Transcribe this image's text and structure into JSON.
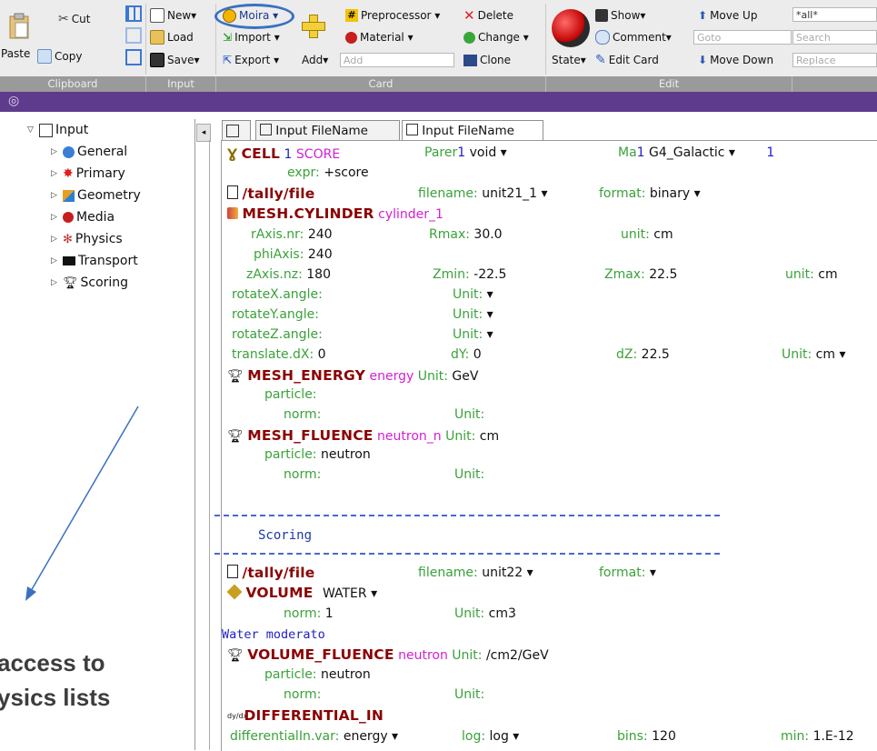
{
  "ribbon": {
    "clipboard": {
      "cut": "Cut",
      "paste": "Paste",
      "copy": "Copy"
    },
    "input": {
      "new": "New▾",
      "load": "Load",
      "save": "Save▾"
    },
    "card": {
      "moira": "Moira ▾",
      "import": "Import ▾",
      "export": "Export ▾",
      "add": "Add▾",
      "add_placeholder": "Add",
      "preprocessor": "Preprocessor ▾",
      "material": "Material ▾",
      "delete": "Delete",
      "change": "Change ▾",
      "clone": "Clone"
    },
    "edit": {
      "state": "State▾",
      "show": "Show▾",
      "comment": "Comment▾",
      "goto_placeholder": "Goto",
      "edit_card": "Edit Card",
      "move_up": "Move Up",
      "move_down": "Move Down",
      "filter_value": "*all*",
      "search_placeholder": "Search",
      "replace_placeholder": "Replace"
    },
    "groups": {
      "clipboard": "Clipboard",
      "input": "Input",
      "card": "Card",
      "edit": "Edit"
    }
  },
  "tree": {
    "root": "Input",
    "items": [
      "General",
      "Primary",
      "Geometry",
      "Media",
      "Physics",
      "Transport",
      "Scoring"
    ]
  },
  "tabs": [
    "Input FileName",
    "Input FileName"
  ],
  "editor": {
    "cell": {
      "name": "CELL",
      "marker": "1",
      "score": "SCORE",
      "parent_label": "Parer",
      "parent_value": "void ▾",
      "mat_label": "Ma",
      "mat_value": "G4_Galactic ▾",
      "expr_label": "expr:",
      "expr_value": "+score"
    },
    "tally1": {
      "name": "/tally/file",
      "filename_label": "filename:",
      "filename_value": "unit21_1 ▾",
      "format_label": "format:",
      "format_value": "binary ▾"
    },
    "mesh_cyl": {
      "name": "MESH.CYLINDER",
      "id": "cylinder_1",
      "r_label": "rAxis.nr:",
      "r_value": "240",
      "rmax_label": "Rmax:",
      "rmax_value": "30.0",
      "unit_label": "unit:",
      "unit_value": "cm",
      "phi_label": "phiAxis:",
      "phi_value": "240",
      "z_label": "zAxis.nz:",
      "z_value": "180",
      "zmin_label": "Zmin:",
      "zmin_value": "-22.5",
      "zmax_label": "Zmax:",
      "zmax_value": "22.5",
      "unit2_label": "unit:",
      "unit2_value": "cm",
      "rx_label": "rotateX.angle:",
      "ry_label": "rotateY.angle:",
      "rz_label": "rotateZ.angle:",
      "runit_label": "Unit:",
      "runit_value": "▾",
      "t_label": "translate.dX:",
      "t_value": "0",
      "dy_label": "dY:",
      "dy_value": "0",
      "dz_label": "dZ:",
      "dz_value": "22.5",
      "tunit_label": "Unit:",
      "tunit_value": "cm ▾"
    },
    "mesh_energy": {
      "name": "MESH_ENERGY",
      "id": "energy",
      "unit_label": "Unit:",
      "unit_value": "GeV",
      "particle_label": "particle:",
      "norm_label": "norm:",
      "nunit_label": "Unit:"
    },
    "mesh_fluence": {
      "name": "MESH_FLUENCE",
      "id": "neutron_n",
      "unit_label": "Unit:",
      "unit_value": "cm",
      "particle_label": "particle:",
      "particle_value": "neutron",
      "norm_label": "norm:",
      "nunit_label": "Unit:"
    },
    "section": "Scoring",
    "tally2": {
      "name": "/tally/file",
      "filename_label": "filename:",
      "filename_value": "unit22 ▾",
      "format_label": "format:",
      "format_value": "▾"
    },
    "volume": {
      "name": "VOLUME",
      "material": "WATER ▾",
      "norm_label": "norm:",
      "norm_value": "1",
      "unit_label": "Unit:",
      "unit_value": "cm3",
      "comment": "Water moderato"
    },
    "volume_fluence": {
      "name": "VOLUME_FLUENCE",
      "id": "neutron",
      "unit_label": "Unit:",
      "unit_value": "/cm2/GeV",
      "particle_label": "particle:",
      "particle_value": "neutron",
      "norm_label": "norm:",
      "nunit_label": "Unit:"
    },
    "differential": {
      "name": "DIFFERENTIAL_IN",
      "icon_text": "dy/dx",
      "var_label": "differentialIn.var:",
      "var_value": "energy ▾",
      "log_label": "log:",
      "log_value": "log ▾",
      "bins_label": "bins:",
      "bins_value": "120",
      "min_label": "min:",
      "min_value": "1.E-12"
    }
  },
  "annotation": {
    "line1": "access to",
    "line2": "ysics lists"
  },
  "colors": {
    "keyword": "#8b0000",
    "field": "#3aa13a",
    "identifier": "#d21fd2",
    "comment": "#2020c8",
    "header": "#5e3b8c",
    "annotation": "#3a70c2"
  }
}
